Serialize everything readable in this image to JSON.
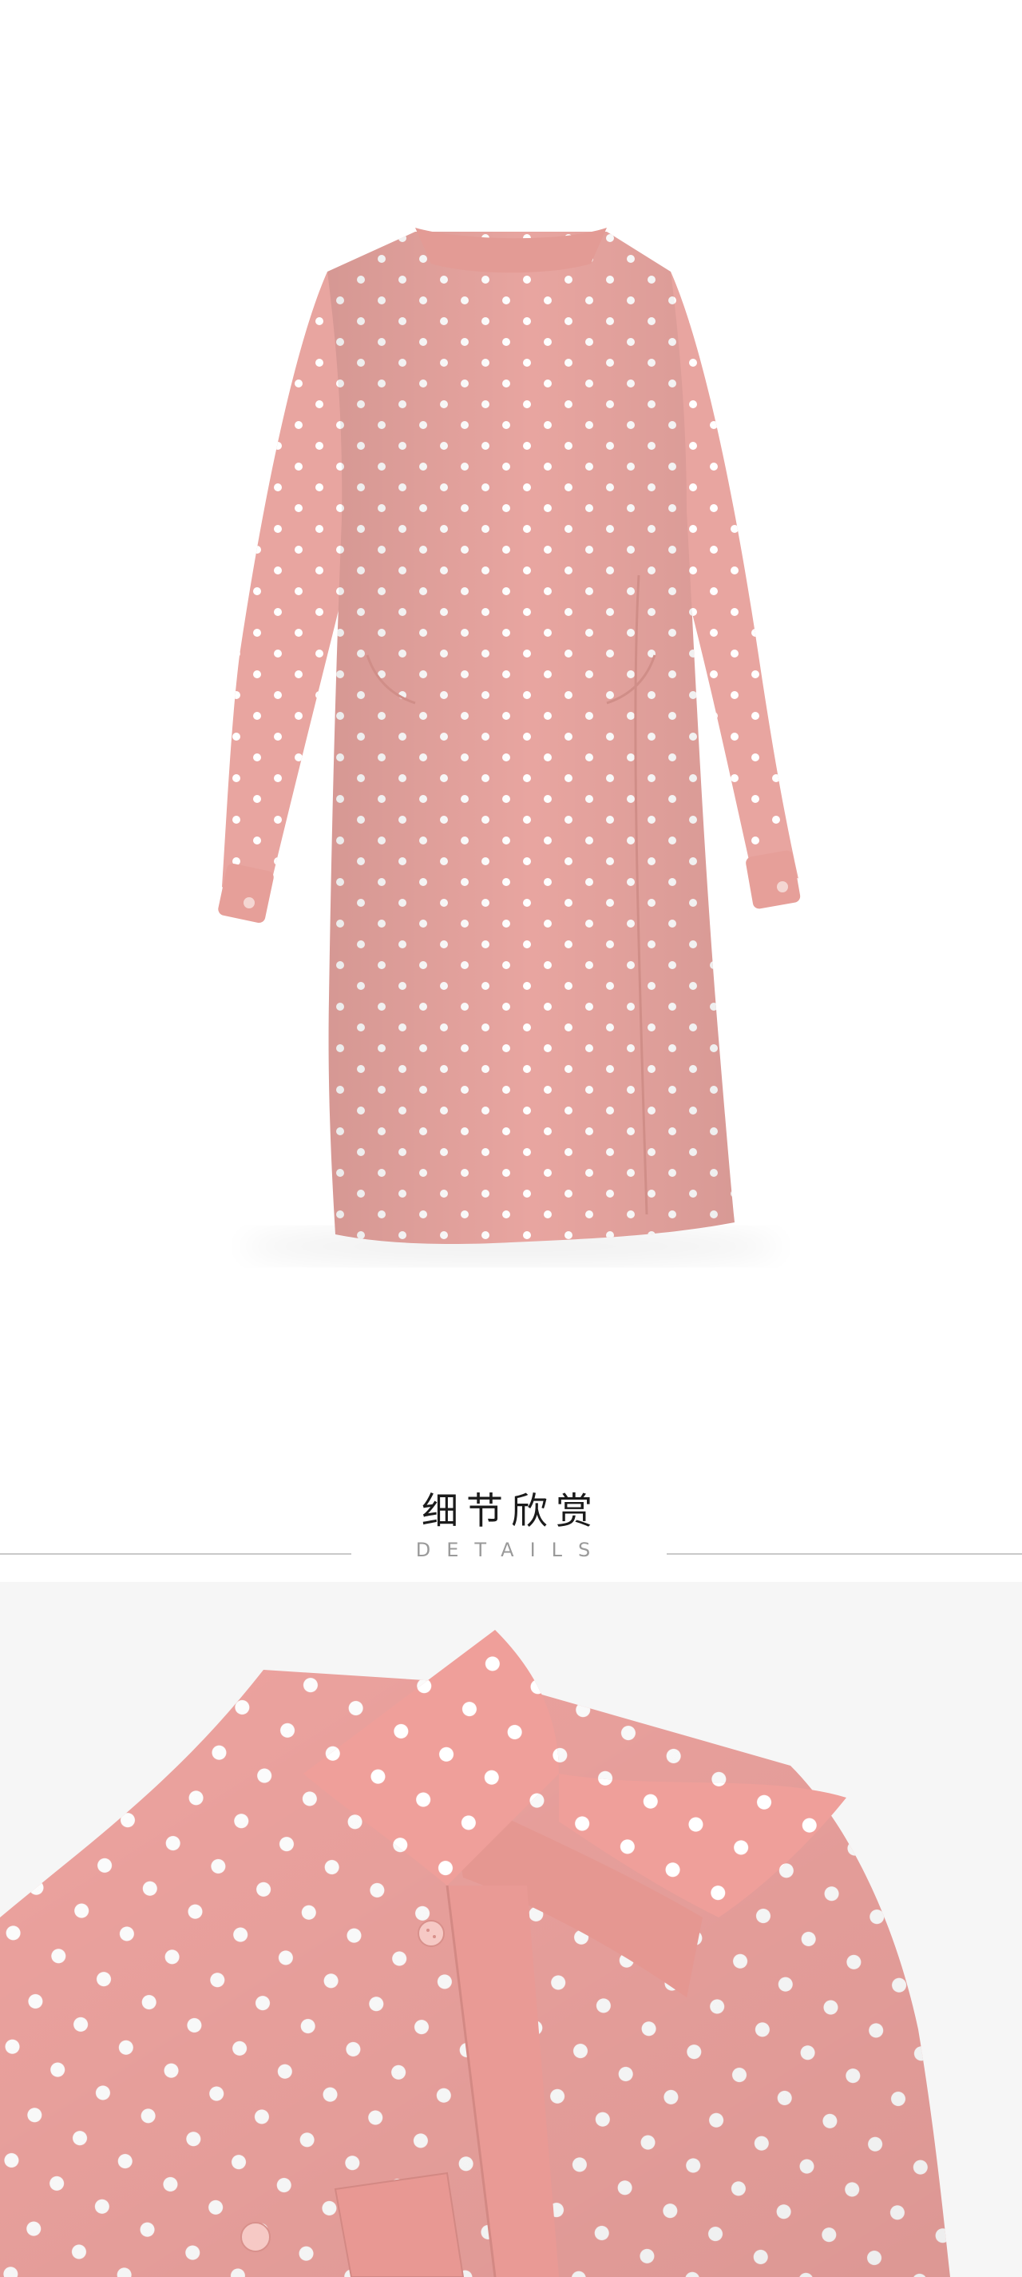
{
  "photos": {
    "back": {
      "subject": "dress-back-view",
      "main_color": "#e8a5a0",
      "dot_color": "#ffffff"
    },
    "detail": {
      "subject": "collar-closeup",
      "main_color": "#eda39f",
      "dot_color": "#ffffff"
    }
  },
  "details_section": {
    "title": "细节欣赏",
    "subtitle": "DETAILS"
  }
}
